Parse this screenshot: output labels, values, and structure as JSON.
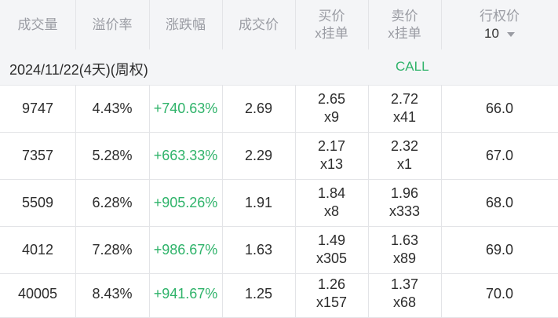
{
  "header": {
    "volume": "成交量",
    "premium": "溢价率",
    "change": "涨跌幅",
    "last_price": "成交价",
    "bid": "买价",
    "bid_sub": "x挂单",
    "ask": "卖价",
    "ask_sub": "x挂单",
    "strike": "行权价",
    "strike_select": "10"
  },
  "section": {
    "date": "2024/11/22(4天)(周权)",
    "type": "CALL"
  },
  "rows": [
    {
      "volume": "9747",
      "premium": "4.43%",
      "change": "+740.63%",
      "price": "2.69",
      "bid": "2.65",
      "bid_size": "x9",
      "ask": "2.72",
      "ask_size": "x41",
      "strike": "66.0"
    },
    {
      "volume": "7357",
      "premium": "5.28%",
      "change": "+663.33%",
      "price": "2.29",
      "bid": "2.17",
      "bid_size": "x13",
      "ask": "2.32",
      "ask_size": "x1",
      "strike": "67.0"
    },
    {
      "volume": "5509",
      "premium": "6.28%",
      "change": "+905.26%",
      "price": "1.91",
      "bid": "1.84",
      "bid_size": "x8",
      "ask": "1.96",
      "ask_size": "x333",
      "strike": "68.0"
    },
    {
      "volume": "4012",
      "premium": "7.28%",
      "change": "+986.67%",
      "price": "1.63",
      "bid": "1.49",
      "bid_size": "x305",
      "ask": "1.63",
      "ask_size": "x89",
      "strike": "69.0"
    },
    {
      "volume": "40005",
      "premium": "8.43%",
      "change": "+941.67%",
      "price": "1.25",
      "bid": "1.26",
      "bid_size": "x157",
      "ask": "1.37",
      "ask_size": "x68",
      "strike": "70.0"
    }
  ],
  "colors": {
    "positive": "#2fb36a",
    "header_text": "#9a9ca3",
    "header_bg": "#f4f5f7"
  }
}
